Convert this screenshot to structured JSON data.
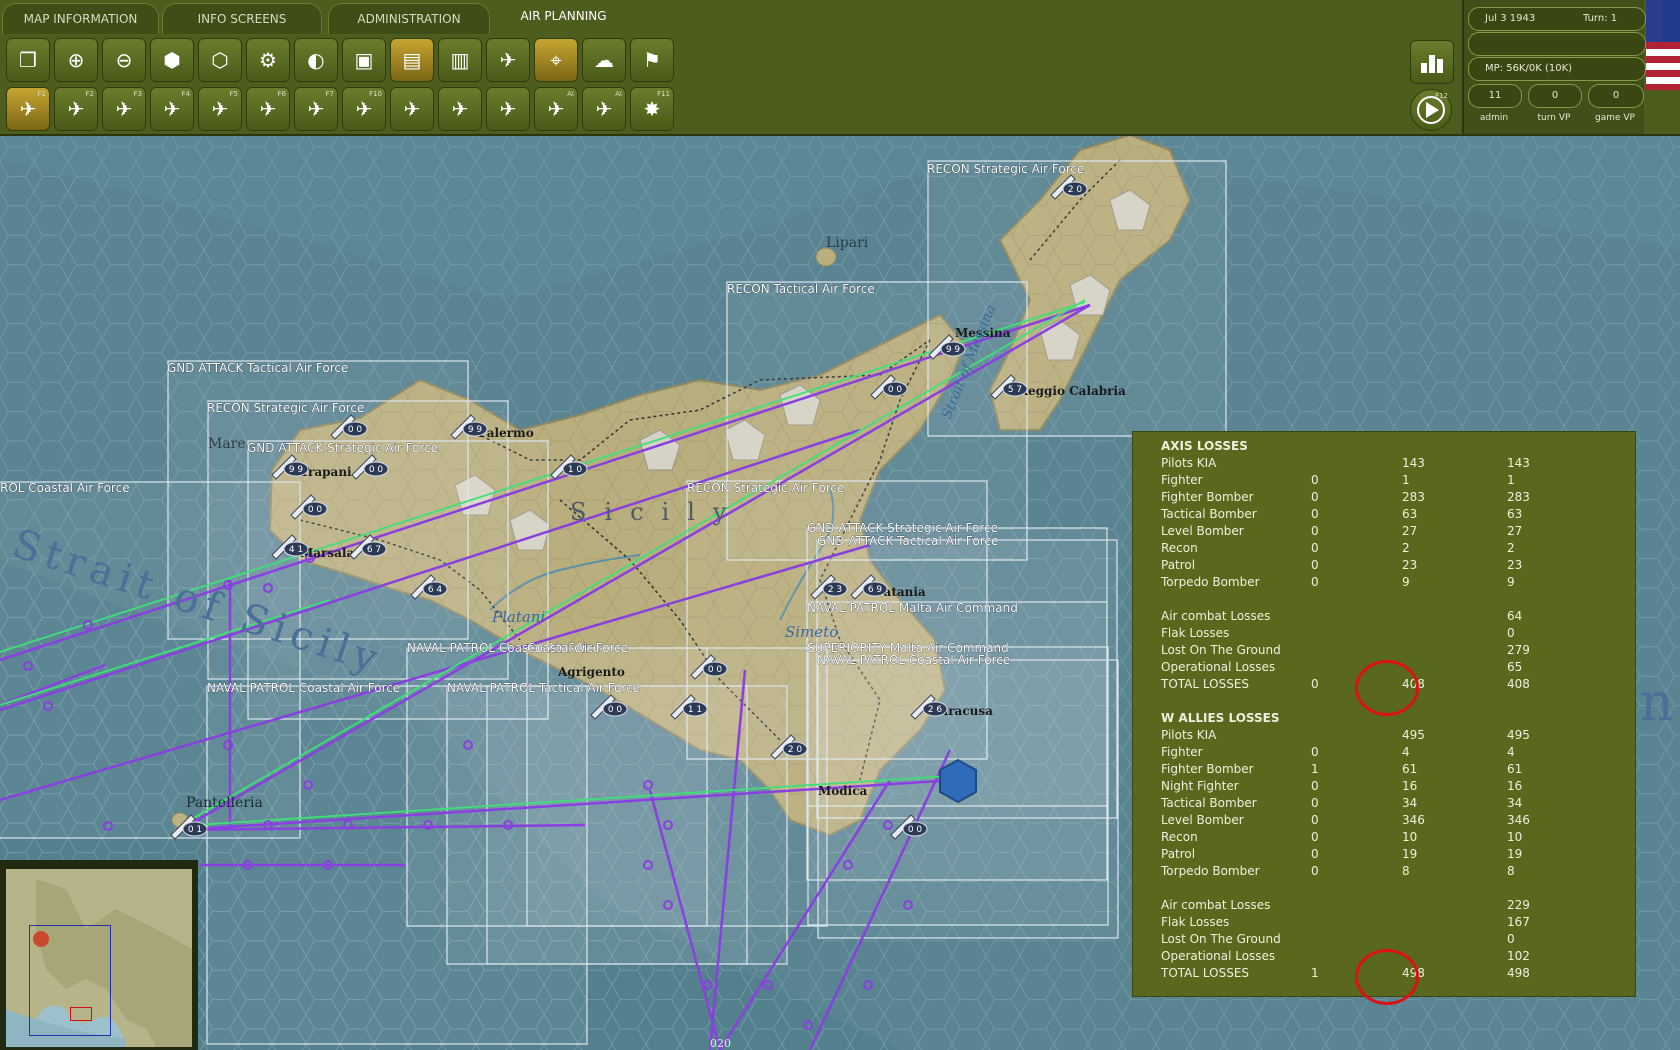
{
  "tabs": [
    {
      "label": "MAP INFORMATION"
    },
    {
      "label": "INFO SCREENS"
    },
    {
      "label": "ADMINISTRATION"
    },
    {
      "label": "AIR PLANNING"
    }
  ],
  "toolbar_row1": [
    {
      "icon": "windows-icon"
    },
    {
      "icon": "zoom-in-icon"
    },
    {
      "icon": "zoom-out-icon"
    },
    {
      "icon": "hexes-icon"
    },
    {
      "icon": "hex-frame-icon"
    },
    {
      "icon": "gear-icon"
    },
    {
      "icon": "unit-toggle-icon"
    },
    {
      "icon": "chart-box-icon"
    },
    {
      "icon": "supply-bars-icon"
    },
    {
      "icon": "signal-bars-icon"
    },
    {
      "icon": "air-bars-icon"
    },
    {
      "icon": "air-target-icon"
    },
    {
      "icon": "weather-icon"
    },
    {
      "icon": "flag-icon"
    }
  ],
  "toolbar_row2": [
    {
      "icon": "air-mission-icon",
      "fkey": "F1"
    },
    {
      "icon": "air-transfer-icon",
      "fkey": "F2"
    },
    {
      "icon": "air-strike-icon",
      "fkey": "F3"
    },
    {
      "icon": "air-city-icon",
      "fkey": "F4"
    },
    {
      "icon": "air-recon-icon",
      "fkey": "F5"
    },
    {
      "icon": "air-superiority-icon",
      "fkey": "F6"
    },
    {
      "icon": "air-naval-icon",
      "fkey": "F7"
    },
    {
      "icon": "air-ground-icon",
      "fkey": "F10"
    },
    {
      "icon": "air-cross-icon",
      "fkey": ""
    },
    {
      "icon": "air-plus-icon",
      "fkey": ""
    },
    {
      "icon": "air-swap-icon",
      "fkey": ""
    },
    {
      "icon": "air-ai-icon",
      "fkey": "AI"
    },
    {
      "icon": "air-ai-plus-icon",
      "fkey": "AI"
    },
    {
      "icon": "explosion-icon",
      "fkey": "F11"
    }
  ],
  "status": {
    "date": "Jul 3 1943",
    "turn": "Turn: 1",
    "mp": "MP: 56K/0K (10K)",
    "admin_value": "11",
    "admin_label": "admin",
    "turn_vp_value": "0",
    "turn_vp_label": "turn VP",
    "game_vp_value": "0",
    "game_vp_label": "game VP"
  },
  "nav": {
    "end_key": "F12"
  },
  "map_labels": {
    "lipari": "Lipari",
    "messina": "Messina",
    "reggio": "Reggio Calabria",
    "palermo": "Palermo",
    "trapani": "Trapani",
    "marsala": "Marsala",
    "marettimo": "Mare",
    "sicily": "Sicily",
    "platani": "Platani",
    "simeto": "Simeto",
    "catania": "Catania",
    "agrigento": "Agrigento",
    "siracusa": "Siracusa",
    "modica": "Modica",
    "pantelleria": "Pantelleria",
    "strait_messina": "Strait of Messina",
    "strait_sicily": "Strait of Sicily",
    "ionian_fragment": "n",
    "bottom_counter": "020"
  },
  "air_missions": [
    "RECON  Strategic Air Force",
    "RECON  Tactical Air Force",
    "GND ATTACK  Tactical Air Force",
    "RECON  Strategic Air Force",
    "GND ATTACK  Strategic Air Force",
    "ROL  Coastal Air Force",
    "RECON  Strategic Air Force",
    "GND ATTACK  Strategic Air Force",
    "GND ATTACK  Tactical Air Force",
    "NAVAL PATROL  Malta Air Command",
    "NAVAL PATROL  Coastal Air Force",
    "Coastal Air Force",
    "SUPERIORITY  Malta Air Command",
    "NAVAL PATROL  Coastal Air Force",
    "NAVAL PATROL  Coastal Air Force",
    "NAVAL PATROL  Tactical Air Force"
  ],
  "unit_counters": [
    "2 0",
    "9 9",
    "0 0",
    "5 7",
    "9 9",
    "0 0",
    "9 9",
    "0 0",
    "1 0",
    "0 0",
    "4 1",
    "6 7",
    "6 4",
    "2 3",
    "6 9",
    "0 0",
    "0 0",
    "1 1",
    "2 6",
    "2 0",
    "0 0",
    "0 1"
  ],
  "axis_losses": {
    "header": "AXIS LOSSES",
    "rows": [
      {
        "label": "Pilots KIA",
        "c1": "",
        "c2": "143",
        "c3": "143"
      },
      {
        "label": "Fighter",
        "c1": "0",
        "c2": "1",
        "c3": "1"
      },
      {
        "label": "Fighter Bomber",
        "c1": "0",
        "c2": "283",
        "c3": "283"
      },
      {
        "label": "Tactical Bomber",
        "c1": "0",
        "c2": "63",
        "c3": "63"
      },
      {
        "label": "Level Bomber",
        "c1": "0",
        "c2": "27",
        "c3": "27"
      },
      {
        "label": "Recon",
        "c1": "0",
        "c2": "2",
        "c3": "2"
      },
      {
        "label": "Patrol",
        "c1": "0",
        "c2": "23",
        "c3": "23"
      },
      {
        "label": "Torpedo Bomber",
        "c1": "0",
        "c2": "9",
        "c3": "9"
      }
    ],
    "summary": [
      {
        "label": "Air combat Losses",
        "c1": "",
        "c2": "",
        "c3": "64"
      },
      {
        "label": "Flak Losses",
        "c1": "",
        "c2": "",
        "c3": "0"
      },
      {
        "label": "Lost On The Ground",
        "c1": "",
        "c2": "",
        "c3": "279"
      },
      {
        "label": "Operational Losses",
        "c1": "",
        "c2": "",
        "c3": "65"
      },
      {
        "label": "TOTAL LOSSES",
        "c1": "0",
        "c2": "408",
        "c3": "408"
      }
    ]
  },
  "allied_losses": {
    "header": "W ALLIES LOSSES",
    "rows": [
      {
        "label": "Pilots KIA",
        "c1": "",
        "c2": "495",
        "c3": "495"
      },
      {
        "label": "Fighter",
        "c1": "0",
        "c2": "4",
        "c3": "4"
      },
      {
        "label": "Fighter Bomber",
        "c1": "1",
        "c2": "61",
        "c3": "61"
      },
      {
        "label": "Night Fighter",
        "c1": "0",
        "c2": "16",
        "c3": "16"
      },
      {
        "label": "Tactical Bomber",
        "c1": "0",
        "c2": "34",
        "c3": "34"
      },
      {
        "label": "Level Bomber",
        "c1": "0",
        "c2": "346",
        "c3": "346"
      },
      {
        "label": "Recon",
        "c1": "0",
        "c2": "10",
        "c3": "10"
      },
      {
        "label": "Patrol",
        "c1": "0",
        "c2": "19",
        "c3": "19"
      },
      {
        "label": "Torpedo Bomber",
        "c1": "0",
        "c2": "8",
        "c3": "8"
      }
    ],
    "summary": [
      {
        "label": "Air combat Losses",
        "c1": "",
        "c2": "",
        "c3": "229"
      },
      {
        "label": "Flak Losses",
        "c1": "",
        "c2": "",
        "c3": "167"
      },
      {
        "label": "Lost On The Ground",
        "c1": "",
        "c2": "",
        "c3": "0"
      },
      {
        "label": "Operational Losses",
        "c1": "",
        "c2": "",
        "c3": "102"
      },
      {
        "label": "TOTAL LOSSES",
        "c1": "1",
        "c2": "498",
        "c3": "498"
      }
    ]
  },
  "colors": {
    "ui_green": "#4d5d1d",
    "panel_green": "#59681d",
    "sea": "#5c8794",
    "land": "#b9ae7e",
    "route_purple": "#8a3fe0",
    "route_green": "#3fe07a",
    "highlight_red": "#dd1111"
  }
}
